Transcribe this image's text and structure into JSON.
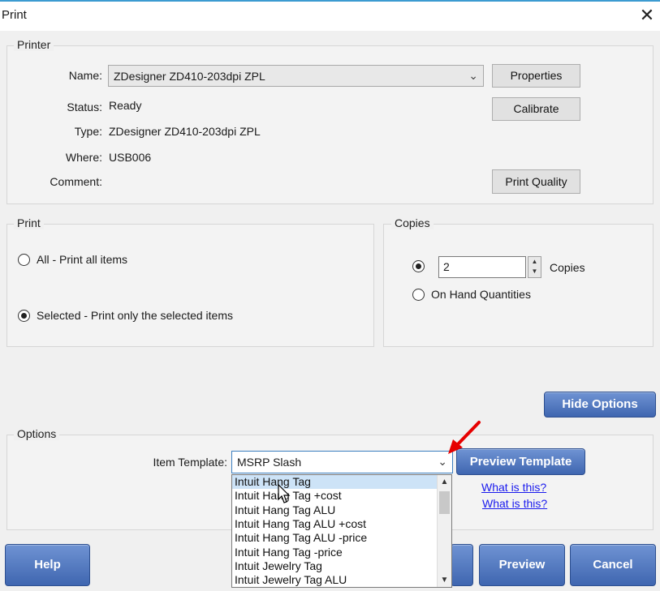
{
  "window": {
    "title": "Print",
    "close_glyph": "✕"
  },
  "printer": {
    "legend": "Printer",
    "name_label": "Name:",
    "name_value": "ZDesigner ZD410-203dpi ZPL",
    "status_label": "Status:",
    "status_value": "Ready",
    "type_label": "Type:",
    "type_value": "ZDesigner ZD410-203dpi ZPL",
    "where_label": "Where:",
    "where_value": "USB006",
    "comment_label": "Comment:",
    "comment_value": "",
    "properties_btn": "Properties",
    "calibrate_btn": "Calibrate",
    "print_quality_btn": "Print Quality"
  },
  "print_group": {
    "legend": "Print",
    "all_label": "All - Print all items",
    "all_selected": false,
    "selected_label": "Selected - Print only the selected items",
    "selected_selected": true
  },
  "copies": {
    "legend": "Copies",
    "count_value": "2",
    "copies_label": "Copies",
    "copies_selected": true,
    "on_hand_label": "On Hand Quantities",
    "on_hand_selected": false
  },
  "hide_options_btn": "Hide Options",
  "options": {
    "legend": "Options",
    "item_template_label": "Item Template:",
    "item_template_value": "MSRP Slash",
    "preview_template_btn": "Preview Template",
    "what_is_this_1": "What is this?",
    "what_is_this_2": "What is this?",
    "dropdown_items": [
      "Intuit Hang Tag",
      "Intuit Hang Tag +cost",
      "Intuit Hang Tag ALU",
      "Intuit Hang Tag ALU +cost",
      "Intuit Hang Tag ALU -price",
      "Intuit Hang Tag -price",
      "Intuit Jewelry Tag",
      "Intuit Jewelry Tag ALU"
    ],
    "dropdown_highlight_index": 0
  },
  "footer": {
    "help_btn": "Help",
    "preview_btn": "Preview",
    "cancel_btn": "Cancel"
  },
  "colors": {
    "accent_blue": "#4a70b8",
    "link": "#1a1aee",
    "arrow_red": "#e60000",
    "dialog_bg": "#f0f0f0"
  }
}
